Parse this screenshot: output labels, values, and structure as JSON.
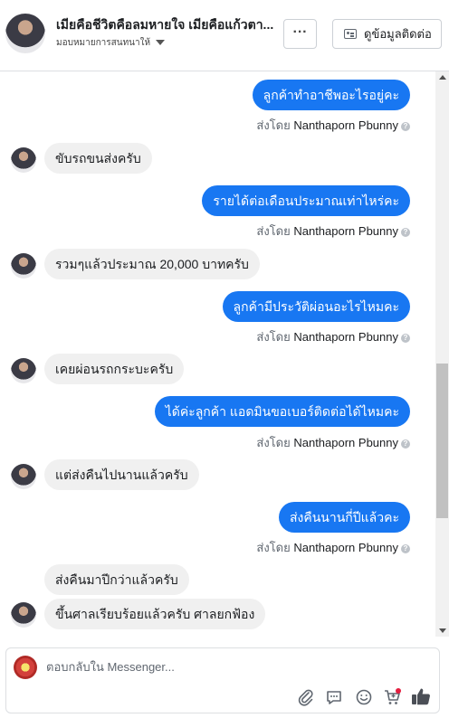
{
  "header": {
    "title": "เมียคือชีวิตคือลมหายใจ เมียคือแก้วตา...",
    "subtitle": "มอบหมายการสนทนาให้",
    "more_label": "···",
    "contact_label": "ดูข้อมูลติดต่อ"
  },
  "messages": [
    {
      "dir": "out",
      "text": "ลูกค้าทำอาชีพอะไรอยู่คะ",
      "sent_prefix": "ส่งโดย",
      "sender": "Nanthaporn Pbunny"
    },
    {
      "dir": "in",
      "text": "ขับรถขนส่งครับ"
    },
    {
      "dir": "out",
      "text": "รายได้ต่อเดือนประมาณเท่าไหร่คะ",
      "sent_prefix": "ส่งโดย",
      "sender": "Nanthaporn Pbunny"
    },
    {
      "dir": "in",
      "text": "รวมๆแล้วประมาณ 20,000 บาทครับ"
    },
    {
      "dir": "out",
      "text": "ลูกค้ามีประวัติผ่อนอะไรไหมคะ",
      "sent_prefix": "ส่งโดย",
      "sender": "Nanthaporn Pbunny"
    },
    {
      "dir": "in",
      "text": "เคยผ่อนรถกระบะครับ"
    },
    {
      "dir": "out",
      "text": "ได้ค่ะลูกค้า แอดมินขอเบอร์ติดต่อได้ไหมคะ",
      "sent_prefix": "ส่งโดย",
      "sender": "Nanthaporn Pbunny"
    },
    {
      "dir": "in",
      "text": "แต่ส่งคืนไปนานแล้วครับ"
    },
    {
      "dir": "out",
      "text": "ส่งคืนนานกี่ปีแล้วคะ",
      "sent_prefix": "ส่งโดย",
      "sender": "Nanthaporn Pbunny"
    },
    {
      "dir": "in",
      "text": "ส่งคืนมาปีกว่าแล้วครับ"
    },
    {
      "dir": "in",
      "text": "ขึ้นศาลเรียบร้อยแล้วครับ ศาลยกฟ้อง"
    }
  ],
  "composer": {
    "placeholder": "ตอบกลับใน Messenger...",
    "tools": [
      "attachment-icon",
      "message-icon",
      "emoji-icon",
      "shop-icon",
      "like-icon"
    ]
  },
  "colors": {
    "accent": "#1877f2",
    "incoming_bubble": "#f0f0f0",
    "notify_dot": "#e41e3f"
  }
}
